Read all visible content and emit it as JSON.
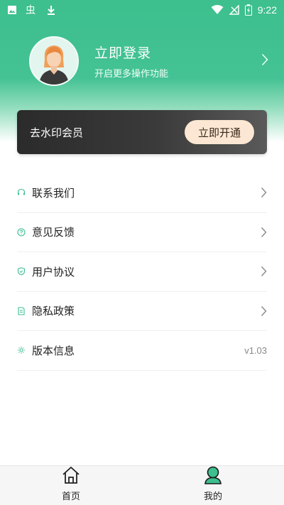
{
  "status_bar": {
    "time": "9:22",
    "icons": [
      "image-icon",
      "app-icon",
      "download-icon",
      "wifi-icon",
      "signal-icon",
      "battery-icon"
    ]
  },
  "profile": {
    "title": "立即登录",
    "subtitle": "开启更多操作功能"
  },
  "vip": {
    "label": "去水印会员",
    "button_label": "立即开通"
  },
  "menu": {
    "items": [
      {
        "label": "联系我们",
        "icon": "headset-icon"
      },
      {
        "label": "意见反馈",
        "icon": "question-icon"
      },
      {
        "label": "用户协议",
        "icon": "shield-icon"
      },
      {
        "label": "隐私政策",
        "icon": "document-icon"
      },
      {
        "label": "版本信息",
        "icon": "gear-icon",
        "value": "v1.03"
      }
    ]
  },
  "bottom_nav": {
    "tabs": [
      {
        "label": "首页",
        "icon": "home-icon"
      },
      {
        "label": "我的",
        "icon": "user-icon",
        "active": true
      }
    ]
  },
  "colors": {
    "brand": "#3dbf8e",
    "vip_button": "#fbe7d3",
    "vip_card": "#2b2b2b"
  }
}
